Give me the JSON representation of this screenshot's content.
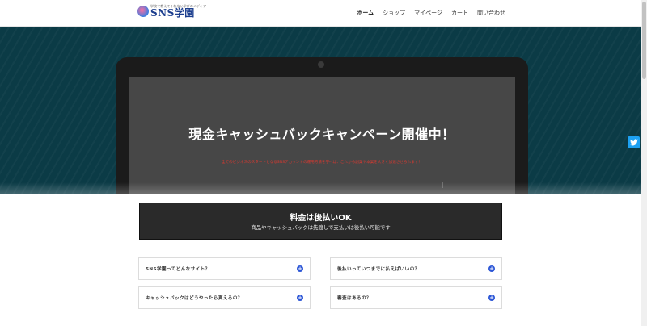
{
  "header": {
    "logo": {
      "tagline": "学校で教えてくれない学びのメディア",
      "name": "SNS学園"
    },
    "nav": [
      {
        "label": "ホーム",
        "active": true
      },
      {
        "label": "ショップ",
        "active": false
      },
      {
        "label": "マイページ",
        "active": false
      },
      {
        "label": "カート",
        "active": false
      },
      {
        "label": "問い合わせ",
        "active": false
      }
    ]
  },
  "hero": {
    "title": "現金キャッシュバックキャンペーン開催中！",
    "subtitle": "全てのビジネスのスタートとなるSNSアカウントの運用方法を学べば、これから副業や本業を大きく加速させられます！",
    "colors": {
      "background": "#0b3b46",
      "subtitle": "#e0382f"
    }
  },
  "banner": {
    "title": "料金は後払いOK",
    "subtitle": "商品やキャッシュバックは先渡しで支払いは後払い可能です"
  },
  "faq": [
    {
      "question": "SNS学園ってどんなサイト？"
    },
    {
      "question": "後払いっていつまでに払えばいいの？"
    },
    {
      "question": "キャッシュバックはどうやったら貰えるの？"
    },
    {
      "question": "審査はあるの？"
    }
  ],
  "icons": {
    "social": "twitter-icon",
    "faq_toggle": "plus-circle-icon"
  },
  "accent_color": "#2c56d6"
}
